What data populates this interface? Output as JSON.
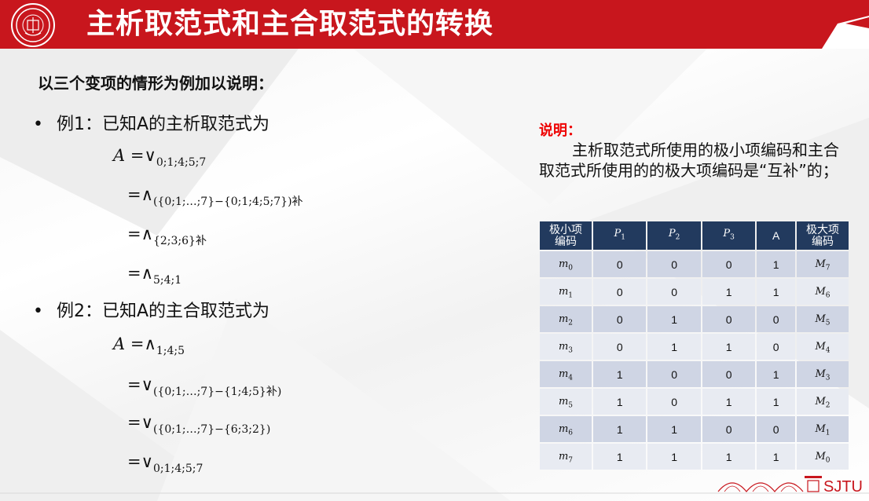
{
  "header": {
    "title": "主析取范式和主合取范式的转换",
    "colors": {
      "header_bg": "#c8161d",
      "table_header_bg": "#223a5e",
      "note_title": "#e00000"
    }
  },
  "intro": "以三个变项的情形为例加以说明：",
  "example1": {
    "bullet": "•",
    "label": "例1：已知A的主析取范式为",
    "f1_lhs": "A",
    "f1_op": "=∨",
    "f1_sub": "0;1;4;5;7",
    "f2_op": "=∧",
    "f2_sub": "({0;1;…;7}−{0;1;4;5;7})",
    "f2_suffix": "补",
    "f3_op": "=∧",
    "f3_sub": "{2;3;6}",
    "f3_suffix": "补",
    "f4_op": "=∧",
    "f4_sub": "5;4;1"
  },
  "example2": {
    "bullet": "•",
    "label": "例2：已知A的主合取范式为",
    "f1_lhs": "A",
    "f1_op": "=∧",
    "f1_sub": "1;4;5",
    "f2_op": "=∨",
    "f2_sub_a": "({0;1;…;7}−{1;4;5}",
    "f2_suffix": "补",
    "f2_sub_b": ")",
    "f3_op": "=∨",
    "f3_sub": "({0;1;…;7}−{6;3;2})",
    "f4_op": "=∨",
    "f4_sub": "0;1;4;5;7"
  },
  "note": {
    "title": "说明：",
    "body": "主析取范式所使用的极小项编码和主合取范式所使用的的极大项编码是“互补”的；"
  },
  "table": {
    "headers": [
      "极小项\n编码",
      "P1",
      "P2",
      "P3",
      "A",
      "极大项\n编码"
    ],
    "rows": [
      {
        "min": "m",
        "min_sub": "0",
        "p1": "0",
        "p2": "0",
        "p3": "0",
        "a": "1",
        "max": "M",
        "max_sub": "7"
      },
      {
        "min": "m",
        "min_sub": "1",
        "p1": "0",
        "p2": "0",
        "p3": "1",
        "a": "1",
        "max": "M",
        "max_sub": "6"
      },
      {
        "min": "m",
        "min_sub": "2",
        "p1": "0",
        "p2": "1",
        "p3": "0",
        "a": "0",
        "max": "M",
        "max_sub": "5"
      },
      {
        "min": "m",
        "min_sub": "3",
        "p1": "0",
        "p2": "1",
        "p3": "1",
        "a": "0",
        "max": "M",
        "max_sub": "4"
      },
      {
        "min": "m",
        "min_sub": "4",
        "p1": "1",
        "p2": "0",
        "p3": "0",
        "a": "1",
        "max": "M",
        "max_sub": "3"
      },
      {
        "min": "m",
        "min_sub": "5",
        "p1": "1",
        "p2": "0",
        "p3": "1",
        "a": "1",
        "max": "M",
        "max_sub": "2"
      },
      {
        "min": "m",
        "min_sub": "6",
        "p1": "1",
        "p2": "1",
        "p3": "0",
        "a": "0",
        "max": "M",
        "max_sub": "1"
      },
      {
        "min": "m",
        "min_sub": "7",
        "p1": "1",
        "p2": "1",
        "p3": "1",
        "a": "1",
        "max": "M",
        "max_sub": "0"
      }
    ]
  },
  "footer": {
    "brand": "SJTU"
  }
}
